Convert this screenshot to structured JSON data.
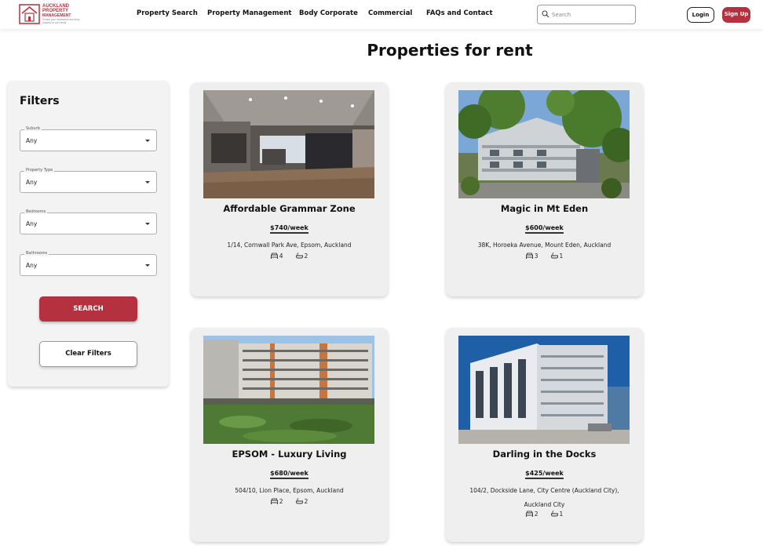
{
  "header": {
    "logo_line1": "AUCKLAND",
    "logo_line2": "PROPERTY",
    "logo_line3": "MANAGEMENT",
    "logo_tagline": "Protect your investment and keep property in our hands",
    "nav": [
      "Property Search",
      "Property Management",
      "Body Corporate",
      "Commercial",
      "FAQs and Contact"
    ],
    "search_placeholder": "Search",
    "login_label": "Login",
    "signup_label": "Sign Up"
  },
  "page_title": "Properties for rent",
  "filters": {
    "title": "Filters",
    "fields": [
      {
        "label": "Suburb",
        "value": "Any"
      },
      {
        "label": "Property Type",
        "value": "Any"
      },
      {
        "label": "Bedrooms",
        "value": "Any"
      },
      {
        "label": "Bathrooms",
        "value": "Any"
      }
    ],
    "search_label": "SEARCH",
    "clear_label": "Clear Filters"
  },
  "listings": [
    {
      "title": "Affordable Grammar Zone",
      "price": "$740/week",
      "address": "1/14, Cornwall Park Ave, Epsom, Auckland",
      "bedrooms": "4",
      "bathrooms": "2"
    },
    {
      "title": "Magic in Mt Eden",
      "price": "$600/week",
      "address": "38K, Horoeka Avenue, Mount Eden, Auckland",
      "bedrooms": "3",
      "bathrooms": "1"
    },
    {
      "title": "EPSOM - Luxury Living",
      "price": "$680/week",
      "address": "504/10, Lion Place, Epsom, Auckland",
      "bedrooms": "2",
      "bathrooms": "2"
    },
    {
      "title": "Darling in the Docks",
      "price": "$425/week",
      "address": "104/2, Dockside Lane, City Centre (Auckland City), Auckland City",
      "bedrooms": "2",
      "bathrooms": "1"
    }
  ],
  "colors": {
    "brand": "#b5313f",
    "card_bg": "#efefef"
  },
  "icons": {
    "bedroom": "bed-icon",
    "bathroom": "bath-icon",
    "search": "search-icon"
  }
}
